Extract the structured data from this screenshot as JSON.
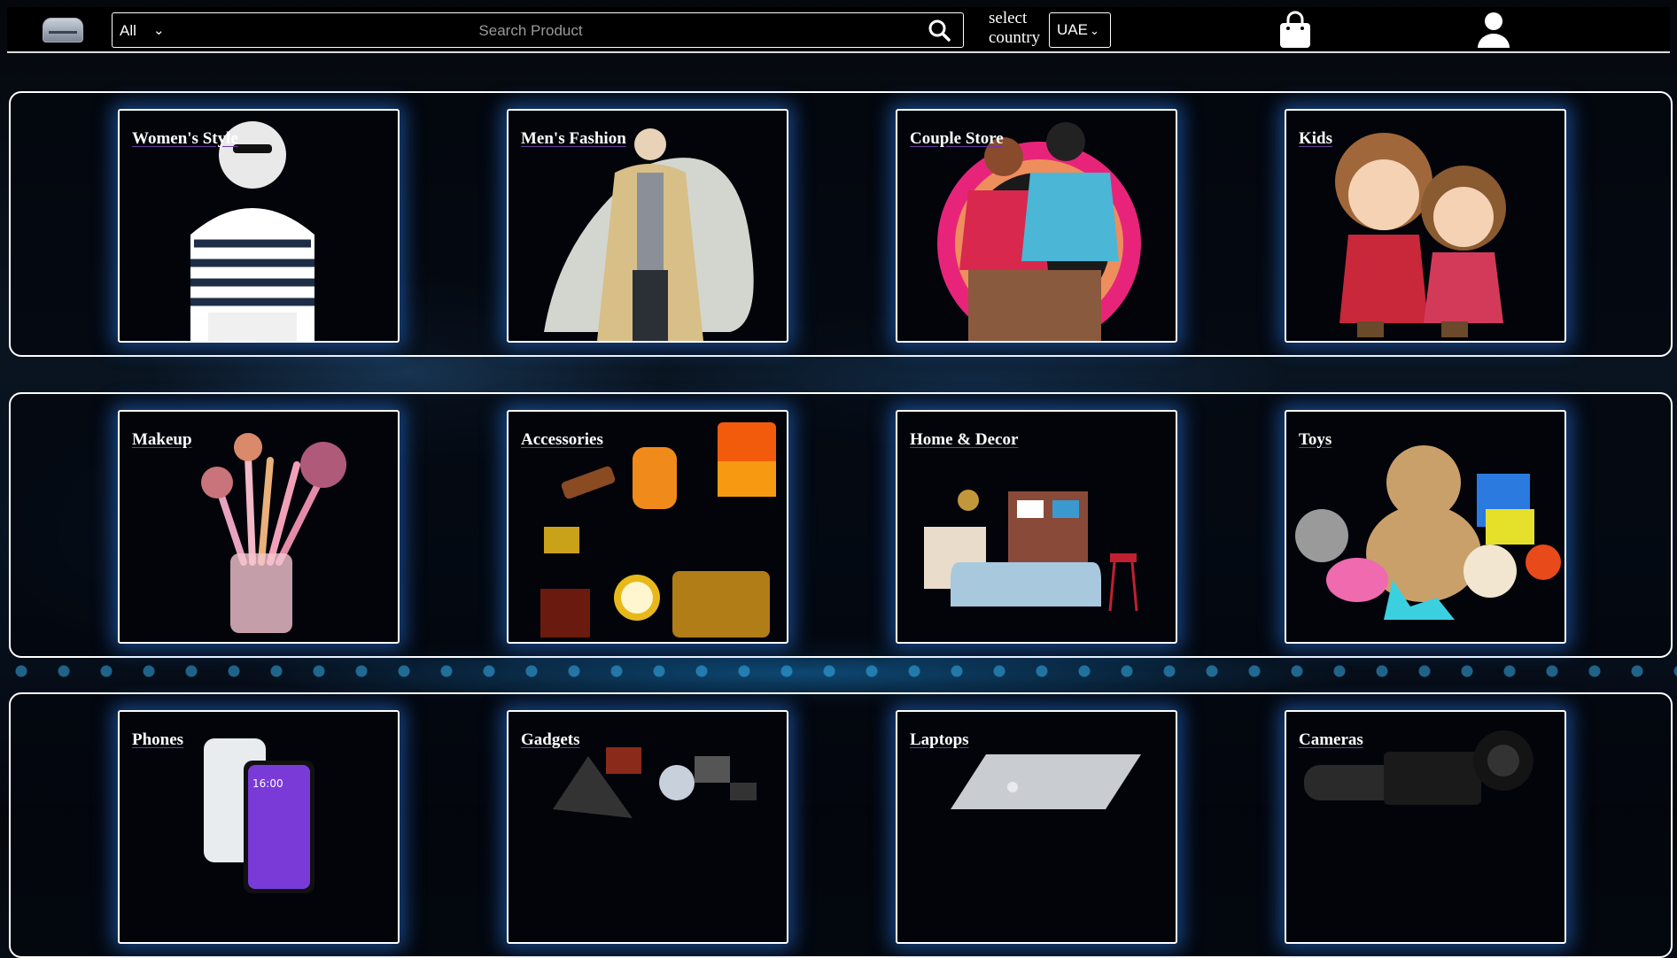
{
  "header": {
    "search": {
      "category": "All",
      "placeholder": "Search Product"
    },
    "country": {
      "label": "select country",
      "value": "UAE"
    }
  },
  "sections": [
    {
      "cards": [
        "Women's Style",
        "Men's Fashion",
        "Couple Store",
        "Kids"
      ]
    },
    {
      "cards": [
        "Makeup",
        "Accessories",
        "Home & Decor",
        "Toys"
      ]
    },
    {
      "cards": [
        "Phones",
        "Gadgets",
        "Laptops",
        "Cameras"
      ]
    }
  ],
  "phone_screen_time": "16:00",
  "colors": {
    "accent_glow": "#2878e6",
    "background": "#05070c",
    "text": "#ffffff"
  }
}
